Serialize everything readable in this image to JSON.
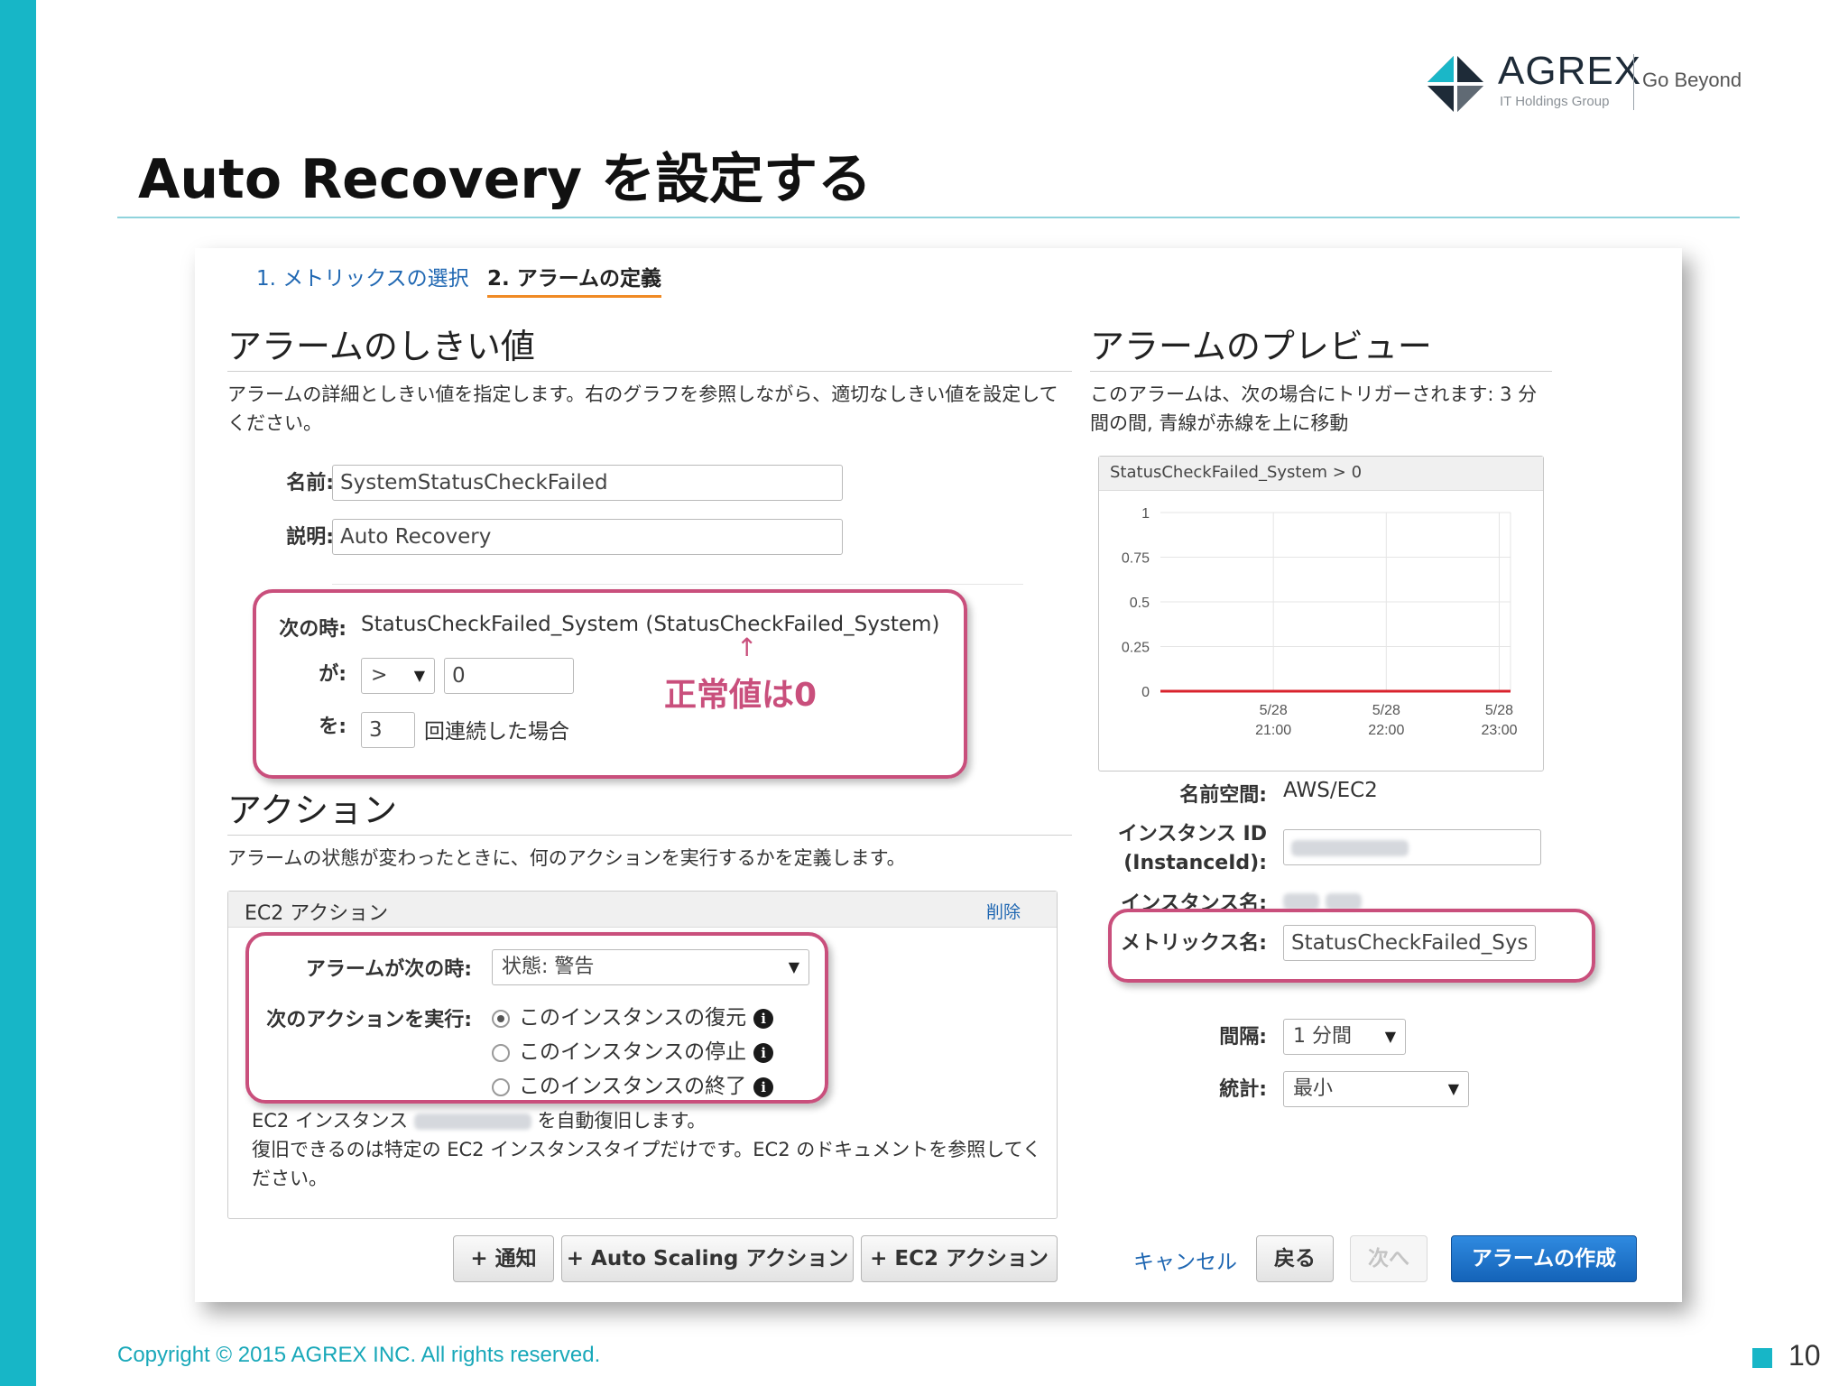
{
  "slide": {
    "title": "Auto Recovery を設定する",
    "footer": "Copyright © 2015 AGREX INC. All rights reserved.",
    "page_number": "10"
  },
  "logo": {
    "name": "AGREX",
    "group": "IT Holdings Group",
    "tagline": "Go Beyond"
  },
  "steps": [
    {
      "label": "1. メトリックスの選択",
      "active": false
    },
    {
      "label": "2. アラームの定義",
      "active": true
    }
  ],
  "threshold": {
    "heading": "アラームのしきい値",
    "description_line1": "アラームの詳細としきい値を指定します。右のグラフを参照しながら、適切なしきい値を設定して",
    "description_line2": "ください。",
    "name_label": "名前:",
    "name_value": "SystemStatusCheckFailed",
    "desc_label": "説明:",
    "desc_value": "Auto Recovery",
    "when_label": "次の時:",
    "when_value": "StatusCheckFailed_System (StatusCheckFailed_System)",
    "is_label": "が:",
    "operator_value": ">",
    "threshold_value": "0",
    "for_label": "を:",
    "periods_value": "3",
    "periods_suffix": "回連続した場合"
  },
  "annotation": {
    "arrow": "↑",
    "text": "正常値は0"
  },
  "actions": {
    "heading": "アクション",
    "description": "アラームの状態が変わったときに、何のアクションを実行するかを定義します。",
    "ec2_box_title": "EC2 アクション",
    "delete_link": "削除",
    "state_label": "アラームが次の時:",
    "state_value": "状態: 警告",
    "do_label": "次のアクションを実行:",
    "options": [
      {
        "label": "このインスタンスの復元",
        "checked": true
      },
      {
        "label": "このインスタンスの停止",
        "checked": false
      },
      {
        "label": "このインスタンスの終了",
        "checked": false
      }
    ],
    "note_prefix": "EC2 インスタンス",
    "note_suffix": "を自動復旧します。",
    "note_line2": "復旧できるのは特定の EC2 インスタンスタイプだけです。EC2 のドキュメントを参照してく",
    "note_line3": "ださい。",
    "add_notification": "+ 通知",
    "add_autoscaling": "+ Auto Scaling アクション",
    "add_ec2": "+ EC2 アクション"
  },
  "preview": {
    "heading": "アラームのプレビュー",
    "description_line1": "このアラームは、次の場合にトリガーされます: 3 分",
    "description_line2": "間の間, 青線が赤線を上に移動",
    "namespace_label": "名前空間:",
    "namespace_value": "AWS/EC2",
    "instance_id_label_1": "インスタンス ID",
    "instance_id_label_2": "(InstanceId):",
    "instance_name_label": "インスタンス名:",
    "metric_label": "メトリックス名:",
    "metric_value": "StatusCheckFailed_Sys",
    "period_label": "間隔:",
    "period_value": "1 分間",
    "statistic_label": "統計:",
    "statistic_value": "最小"
  },
  "footer_buttons": {
    "cancel": "キャンセル",
    "back": "戻る",
    "next": "次へ",
    "create": "アラームの作成"
  },
  "chart_data": {
    "type": "line",
    "title": "StatusCheckFailed_System > 0",
    "x": [
      "5/28 21:00",
      "5/28 22:00",
      "5/28 23:00"
    ],
    "x_tick_top": [
      "5/28",
      "5/28",
      "5/28"
    ],
    "x_tick_bottom": [
      "21:00",
      "22:00",
      "23:00"
    ],
    "y_ticks": [
      "1",
      "0.75",
      "0.5",
      "0.25",
      "0"
    ],
    "ylim": [
      0,
      1
    ],
    "threshold": 0,
    "threshold_color": "#d9232d",
    "grid": true
  },
  "colors": {
    "accent": "#17b6c7",
    "highlight": "#c94f7c",
    "link": "#1f67b2",
    "primary_button": "#1463b8"
  }
}
